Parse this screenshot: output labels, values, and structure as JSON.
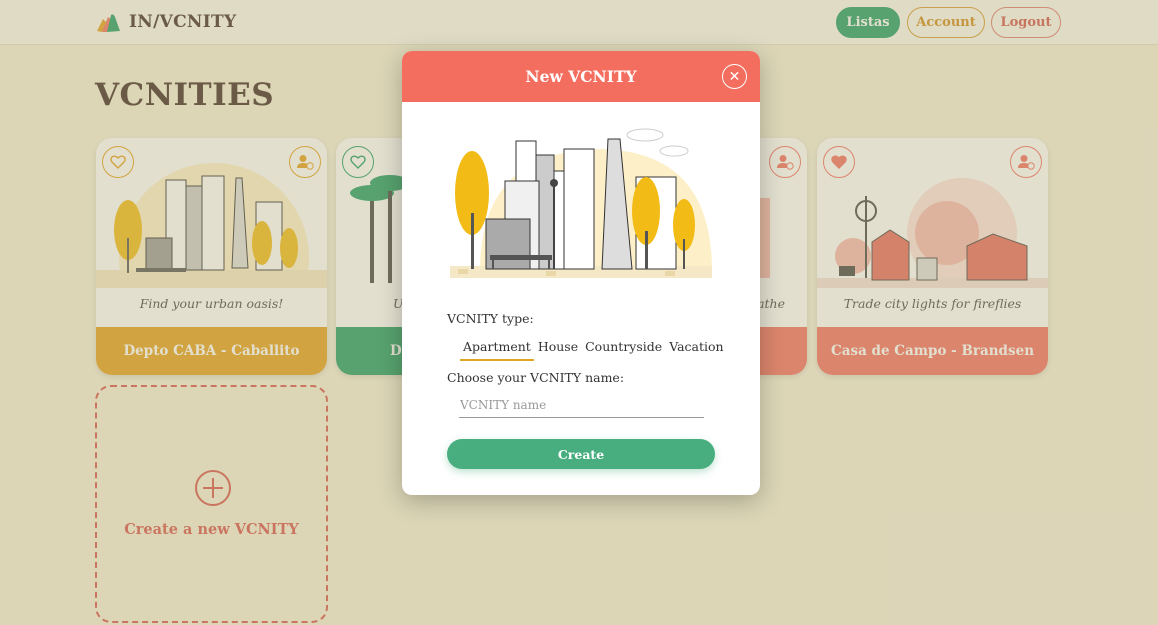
{
  "header": {
    "logo_text": "IN/VCNITY",
    "nav": {
      "listas": "Listas",
      "account": "Account",
      "logout": "Logout"
    }
  },
  "page": {
    "title": "VCNITIES"
  },
  "cards": [
    {
      "tagline": "Find your urban oasis!",
      "title": "Depto CABA - Caballito",
      "color": "#e6a11a",
      "favorited": false
    },
    {
      "tagline": "U",
      "title": "De",
      "color": "#1f9d63",
      "favorited": false
    },
    {
      "tagline": "athe",
      "title": "",
      "color": "#f46e5f",
      "favorited": false
    },
    {
      "tagline": "Trade city lights for fireflies",
      "title": "Casa de Campo - Brandsen",
      "color": "#f46e5f",
      "favorited": true
    }
  ],
  "create_card": {
    "label": "Create a new VCNITY"
  },
  "modal": {
    "title": "New VCNITY",
    "type_label": "VCNITY type:",
    "type_options": [
      "Apartment",
      "House",
      "Countryside",
      "Vacation"
    ],
    "selected_type": "Apartment",
    "name_label": "Choose your VCNITY name:",
    "name_placeholder": "VCNITY name",
    "name_value": "",
    "submit_label": "Create"
  },
  "colors": {
    "primary_green": "#1f9d63",
    "accent_orange": "#e6a11a",
    "coral": "#f46e5f",
    "background": "#f6f0d9"
  }
}
